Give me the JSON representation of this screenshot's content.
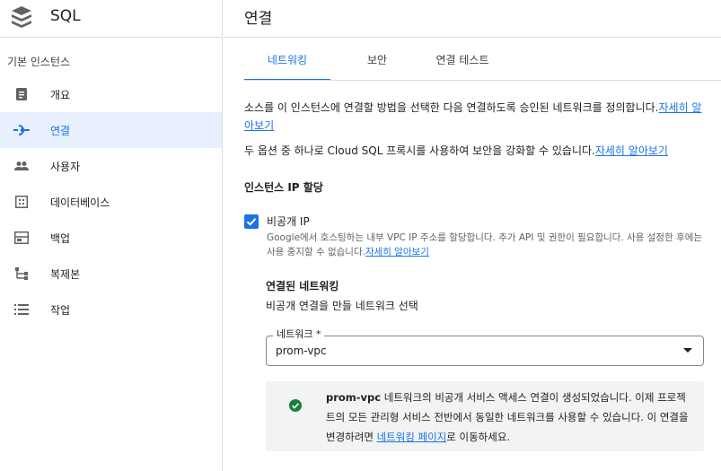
{
  "brand": {
    "title": "SQL",
    "logo_icon": "sql-stack-icon"
  },
  "sidebar": {
    "section_label": "기본 인스턴스",
    "items": [
      {
        "label": "개요",
        "icon": "overview-icon",
        "active": false
      },
      {
        "label": "연결",
        "icon": "connection-icon",
        "active": true
      },
      {
        "label": "사용자",
        "icon": "users-icon",
        "active": false
      },
      {
        "label": "데이터베이스",
        "icon": "database-icon",
        "active": false
      },
      {
        "label": "백업",
        "icon": "backup-icon",
        "active": false
      },
      {
        "label": "복제본",
        "icon": "replica-icon",
        "active": false
      },
      {
        "label": "작업",
        "icon": "operations-icon",
        "active": false
      }
    ]
  },
  "main": {
    "title": "연결",
    "tabs": [
      {
        "label": "네트워킹",
        "active": true
      },
      {
        "label": "보안",
        "active": false
      },
      {
        "label": "연결 테스트",
        "active": false
      }
    ],
    "intro_1": "소스를 이 인스턴스에 연결할 방법을 선택한 다음 연결하도록 승인된 네트워크를 정의합니다.",
    "intro_1_link": "자세히 알아보기",
    "intro_2": "두 옵션 중 하나로 Cloud SQL 프록시를 사용하여 보안을 강화할 수 있습니다.",
    "intro_2_link": "자세히 알아보기",
    "ip_section_title": "인스턴스 IP 할당",
    "private_ip": {
      "label": "비공개 IP",
      "checked": true,
      "help": "Google에서 호스팅하는 내부 VPC IP 주소를 할당합니다. 추가 API 및 권한이 필요합니다. 사용 설정한 후에는 사용 중지할 수 없습니다.",
      "help_link": "자세히 알아보기"
    },
    "connected_network": {
      "title": "연결된 네트워킹",
      "subtitle": "비공개 연결을 만들 네트워크 선택",
      "field_label": "네트워크 *",
      "value": "prom-vpc"
    },
    "notice": {
      "network_name": "prom-vpc",
      "text_1": " 네트워크의 비공개 서비스 액세스 연결이 생성되었습니다. 이제 프로젝트의 모든 관리형 서비스 전반에서 동일한 네트워크를 사용할 수 있습니다. 이 연결을 변경하려면 ",
      "link": "네트워킹 페이지",
      "text_2": "로 이동하세요."
    }
  },
  "colors": {
    "accent": "#1a73e8",
    "success": "#188038",
    "active_bg": "#e8f0fe",
    "muted": "#5f6368"
  }
}
